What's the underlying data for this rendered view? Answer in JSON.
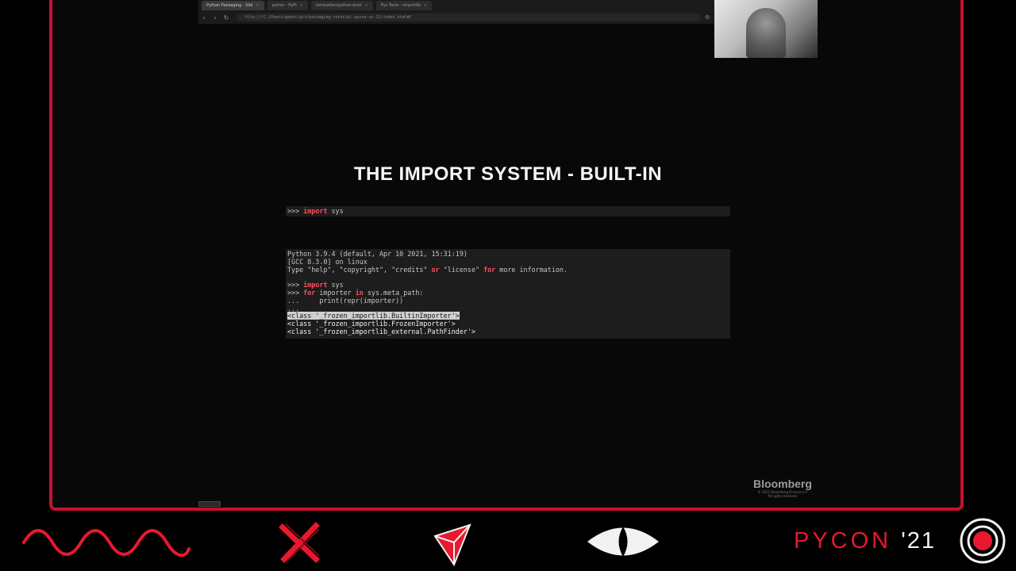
{
  "browser": {
    "tabs": [
      {
        "label": "Python Packaging - Slid",
        "active": true
      },
      {
        "label": "pyiron - PyPI",
        "active": false
      },
      {
        "label": "tomhallier/python-boot",
        "active": false
      },
      {
        "label": "Pyz Tools - importlib",
        "active": false
      }
    ],
    "url": "file:///C:/Users/gabor/git/packaging-tutorial-pycon-us-21/index.html#/"
  },
  "slide": {
    "title": "THE IMPORT SYSTEM - BUILT-IN",
    "code1": {
      "prompt": ">>> ",
      "kw": "import",
      "rest": " sys"
    },
    "session": {
      "line1": "Python 3.9.4 (default, Apr 10 2021, 15:31:19)",
      "line2": "[GCC 8.3.0] on linux",
      "line3a": "Type \"help\", \"copyright\", \"credits\" ",
      "line3kw1": "or",
      "line3b": " \"license\" ",
      "line3kw2": "for",
      "line3c": " more information.",
      "line5prompt": ">>> ",
      "line5kw": "import",
      "line5rest": " sys",
      "line6prompt": ">>> ",
      "line6kw1": "for",
      "line6mid": " importer ",
      "line6kw2": "in",
      "line6rest": " sys.meta_path:",
      "line7": "...     print(repr(importer))",
      "line8": "...",
      "out1": "<class '_frozen_importlib.BuiltinImporter'>",
      "out2": "<class '_frozen_importlib.FrozenImporter'>",
      "out3": "<class '_frozen_importlib_external.PathFinder'>"
    }
  },
  "branding": {
    "bloomberg": "Bloomberg",
    "copyright_line1": "© 2021 Bloomberg Finance L.P.",
    "copyright_line2": "All rights reserved.",
    "pycon": "PYCON",
    "year": "'21"
  },
  "colors": {
    "accent_red": "#e8182e",
    "frame_red": "#c8102e",
    "keyword_red": "#ff4d5e"
  },
  "icons": [
    "wave-icon",
    "x-icon",
    "triangle-icon",
    "eye-icon",
    "target-icon"
  ]
}
